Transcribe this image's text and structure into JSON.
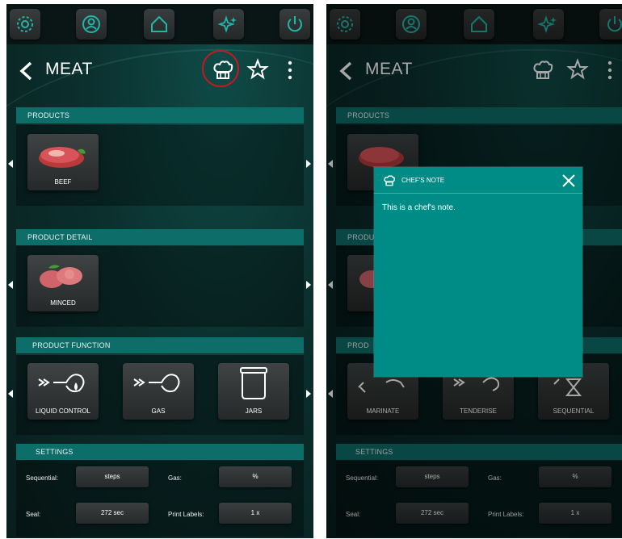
{
  "screens": {
    "left": {
      "title": "MEAT",
      "sections": {
        "products": {
          "header": "PRODUCTS",
          "tiles": [
            {
              "label": "BEEF"
            }
          ]
        },
        "product_detail": {
          "header": "PRODUCT DETAIL",
          "tiles": [
            {
              "label": "MINCED"
            }
          ]
        },
        "product_function": {
          "header": "PRODUCT FUNCTION",
          "tiles": [
            {
              "label": "LIQUID CONTROL"
            },
            {
              "label": "GAS"
            },
            {
              "label": "JARS"
            }
          ]
        },
        "settings": {
          "header": "SETTINGS",
          "rows": [
            {
              "label_a": "Sequential:",
              "value_a": "steps",
              "label_b": "Gas:",
              "value_b": "%"
            },
            {
              "label_a": "Seal:",
              "value_a": "272 sec",
              "label_b": "Print Labels:",
              "value_b": "1 x"
            }
          ]
        }
      }
    },
    "right": {
      "title": "MEAT",
      "sections": {
        "products": {
          "header": "PRODUCTS"
        },
        "product_detail": {
          "header": "PRODU"
        },
        "product_function": {
          "header": "PROD",
          "tiles": [
            {
              "label": "MARINATE"
            },
            {
              "label": "TENDERISE"
            },
            {
              "label": "SEQUENTIAL"
            }
          ]
        },
        "settings": {
          "header": "SETTINGS",
          "rows": [
            {
              "label_a": "Sequential:",
              "value_a": "steps",
              "label_b": "Gas:",
              "value_b": "%"
            },
            {
              "label_a": "Seal:",
              "value_a": "272 sec",
              "label_b": "Print Labels:",
              "value_b": "1 x"
            }
          ]
        }
      },
      "modal": {
        "title": "CHEF'S NOTE",
        "body": "This is a chef's note."
      }
    }
  },
  "icons": {
    "topbar": [
      "gear-icon",
      "user-icon",
      "home-icon",
      "sparkle-icon",
      "power-icon"
    ],
    "titlebar": [
      "back-chevron-icon",
      "chef-hat-icon",
      "star-icon",
      "more-vertical-icon"
    ]
  },
  "colors": {
    "accent_teal": "#0d6d68",
    "modal_teal": "#008c86",
    "highlight_red": "#c8171d",
    "icon_teal": "#1fb7a8"
  }
}
